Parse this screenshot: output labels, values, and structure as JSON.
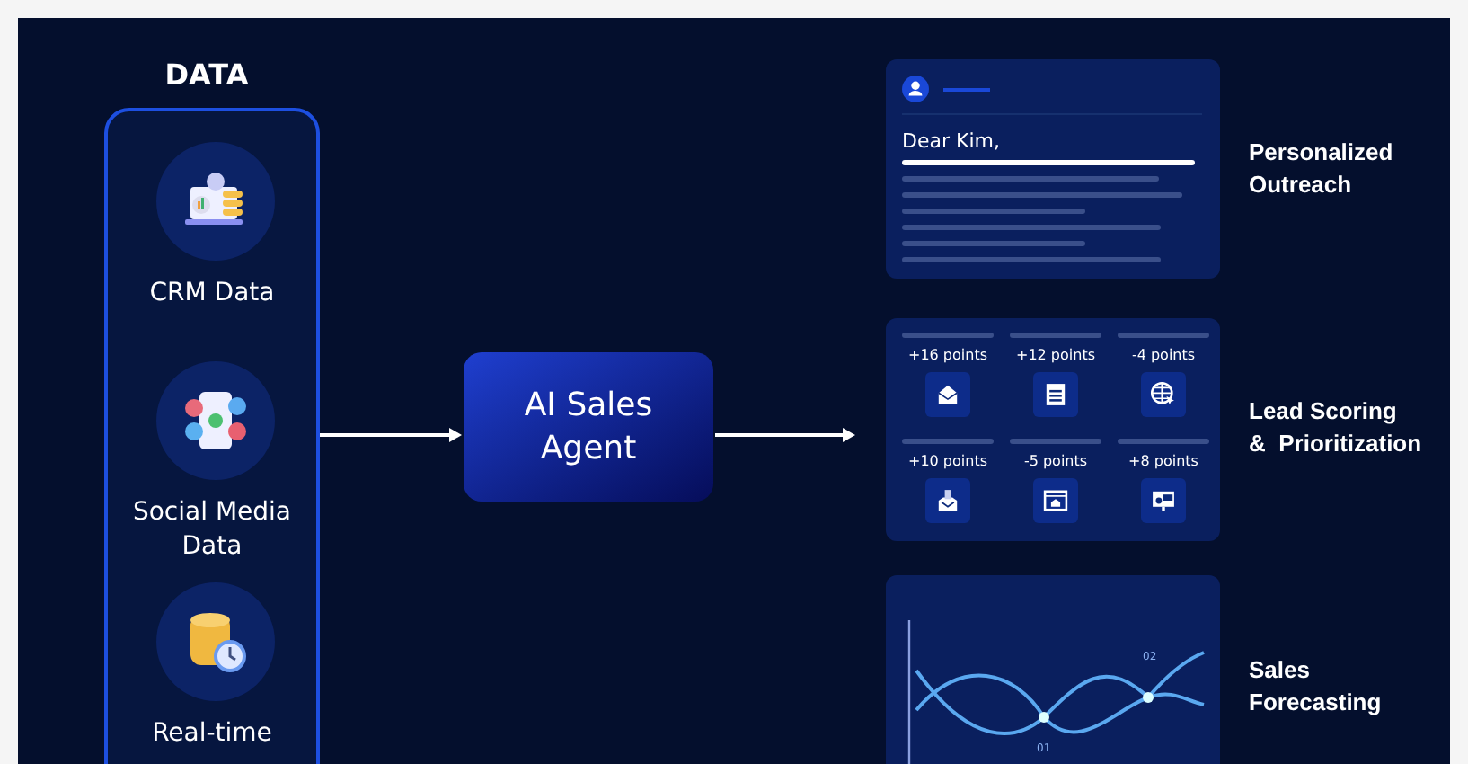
{
  "title": "DATA",
  "sources": [
    {
      "label": "CRM Data"
    },
    {
      "label": "Social Media\nData"
    },
    {
      "label": "Real-time"
    }
  ],
  "agent": {
    "label": "AI Sales\nAgent"
  },
  "outputs": [
    {
      "kind": "email",
      "greeting": "Dear Kim,",
      "label": "Personalized\nOutreach"
    },
    {
      "kind": "scoring",
      "scores": [
        "+16 points",
        "+12 points",
        "-4 points",
        "+10 points",
        "-5 points",
        "+8 points"
      ],
      "label": "Lead Scoring\n&  Prioritization"
    },
    {
      "kind": "forecast",
      "markers": [
        "01",
        "02"
      ],
      "label": "Sales\nForecasting"
    }
  ]
}
